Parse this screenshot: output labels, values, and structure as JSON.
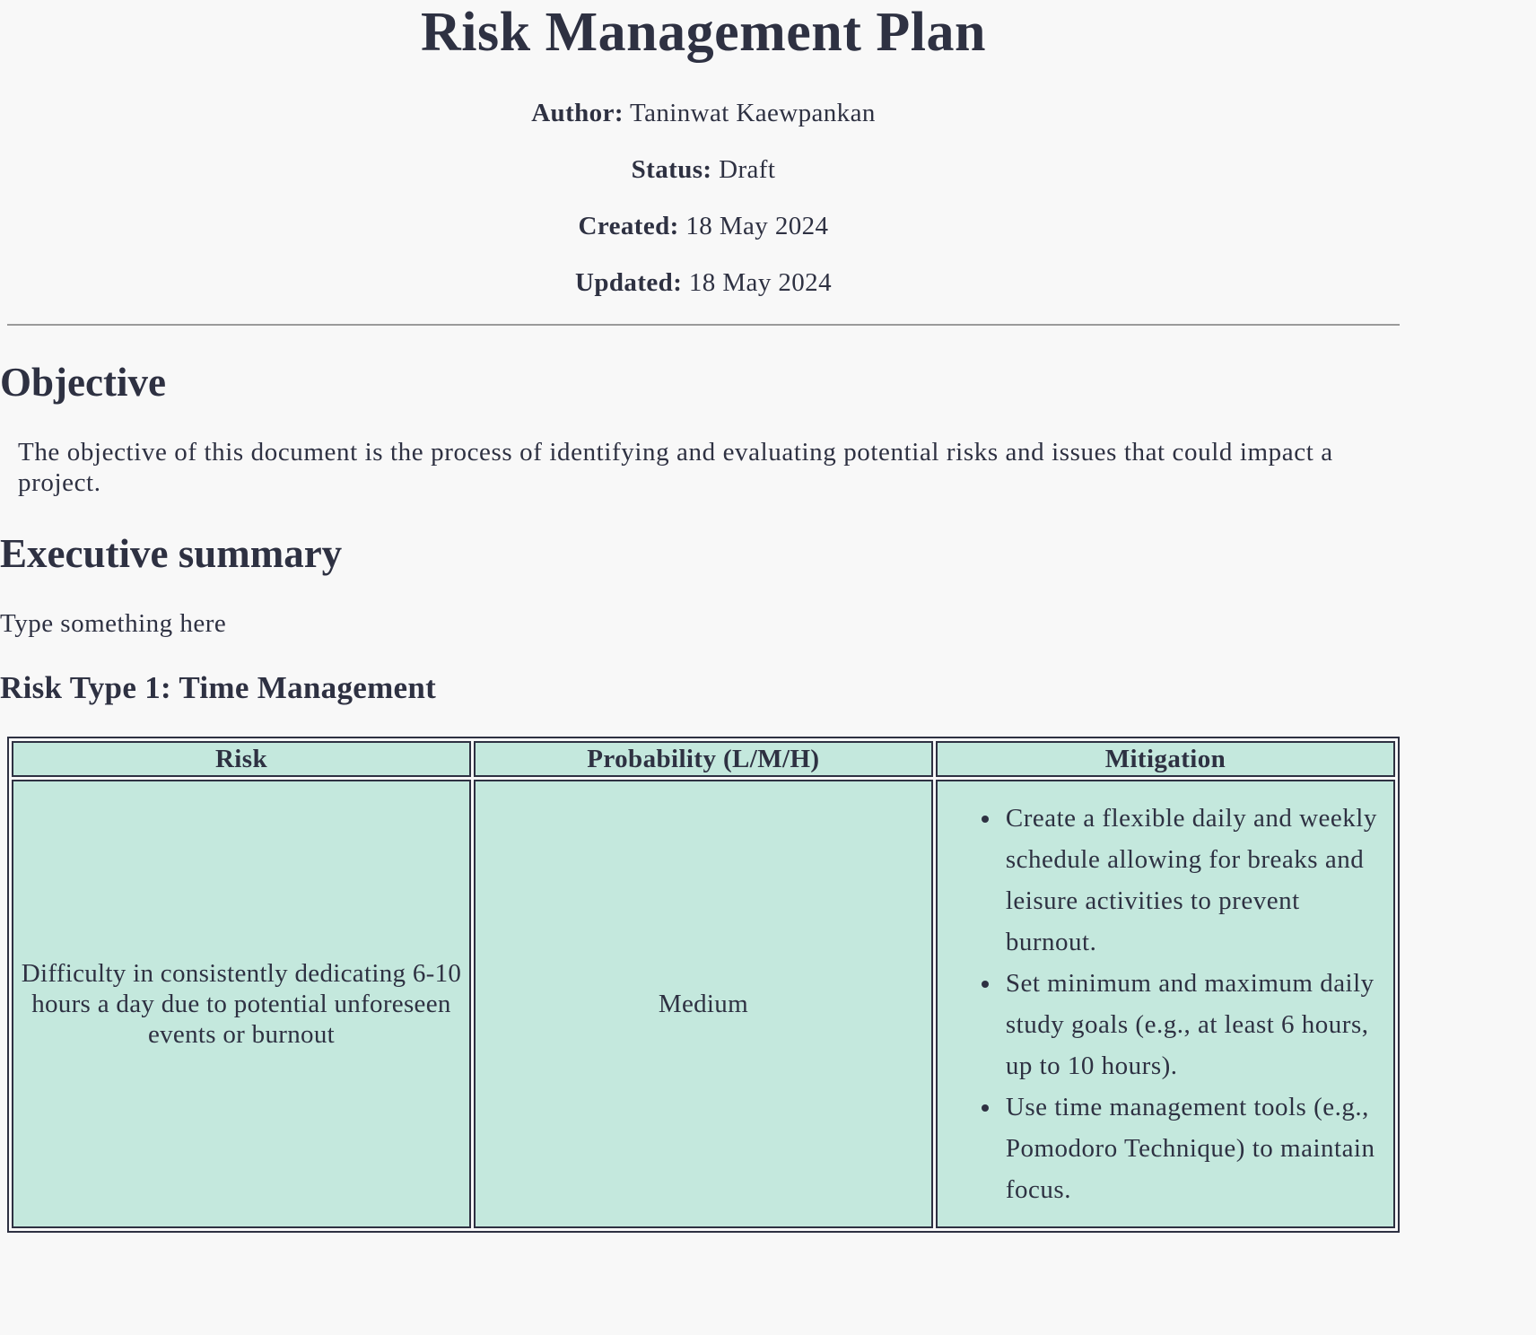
{
  "document": {
    "title": "Risk Management Plan",
    "meta": {
      "author_label": "Author:",
      "author": "Taninwat Kaewpankan",
      "status_label": "Status:",
      "status": "Draft",
      "created_label": "Created:",
      "created": "18 May 2024",
      "updated_label": "Updated:",
      "updated": "18 May 2024"
    },
    "objective": {
      "heading": "Objective",
      "text": "The objective of this document is the process of identifying and evaluating potential risks and issues that could impact a project."
    },
    "executive_summary": {
      "heading": "Executive summary",
      "text": "Type something here"
    },
    "risk_type_1": {
      "heading": "Risk Type 1: Time Management",
      "columns": [
        "Risk",
        "Probability (L/M/H)",
        "Mitigation"
      ],
      "rows": [
        {
          "risk": "Difficulty in consistently dedicating 6-10 hours a day due to potential unforeseen events or burnout",
          "probability": "Medium",
          "mitigation": [
            "Create a flexible daily and weekly schedule allowing for breaks and leisure activities to prevent burnout.",
            "Set minimum and maximum daily study goals (e.g., at least 6 hours, up to 10 hours).",
            "Use time management tools (e.g., Pomodoro Technique) to maintain focus."
          ]
        }
      ]
    }
  },
  "colors": {
    "background": "#f8f8f8",
    "text": "#2e3142",
    "table_cell": "#c4e8dd",
    "divider": "#9a9a9a"
  }
}
